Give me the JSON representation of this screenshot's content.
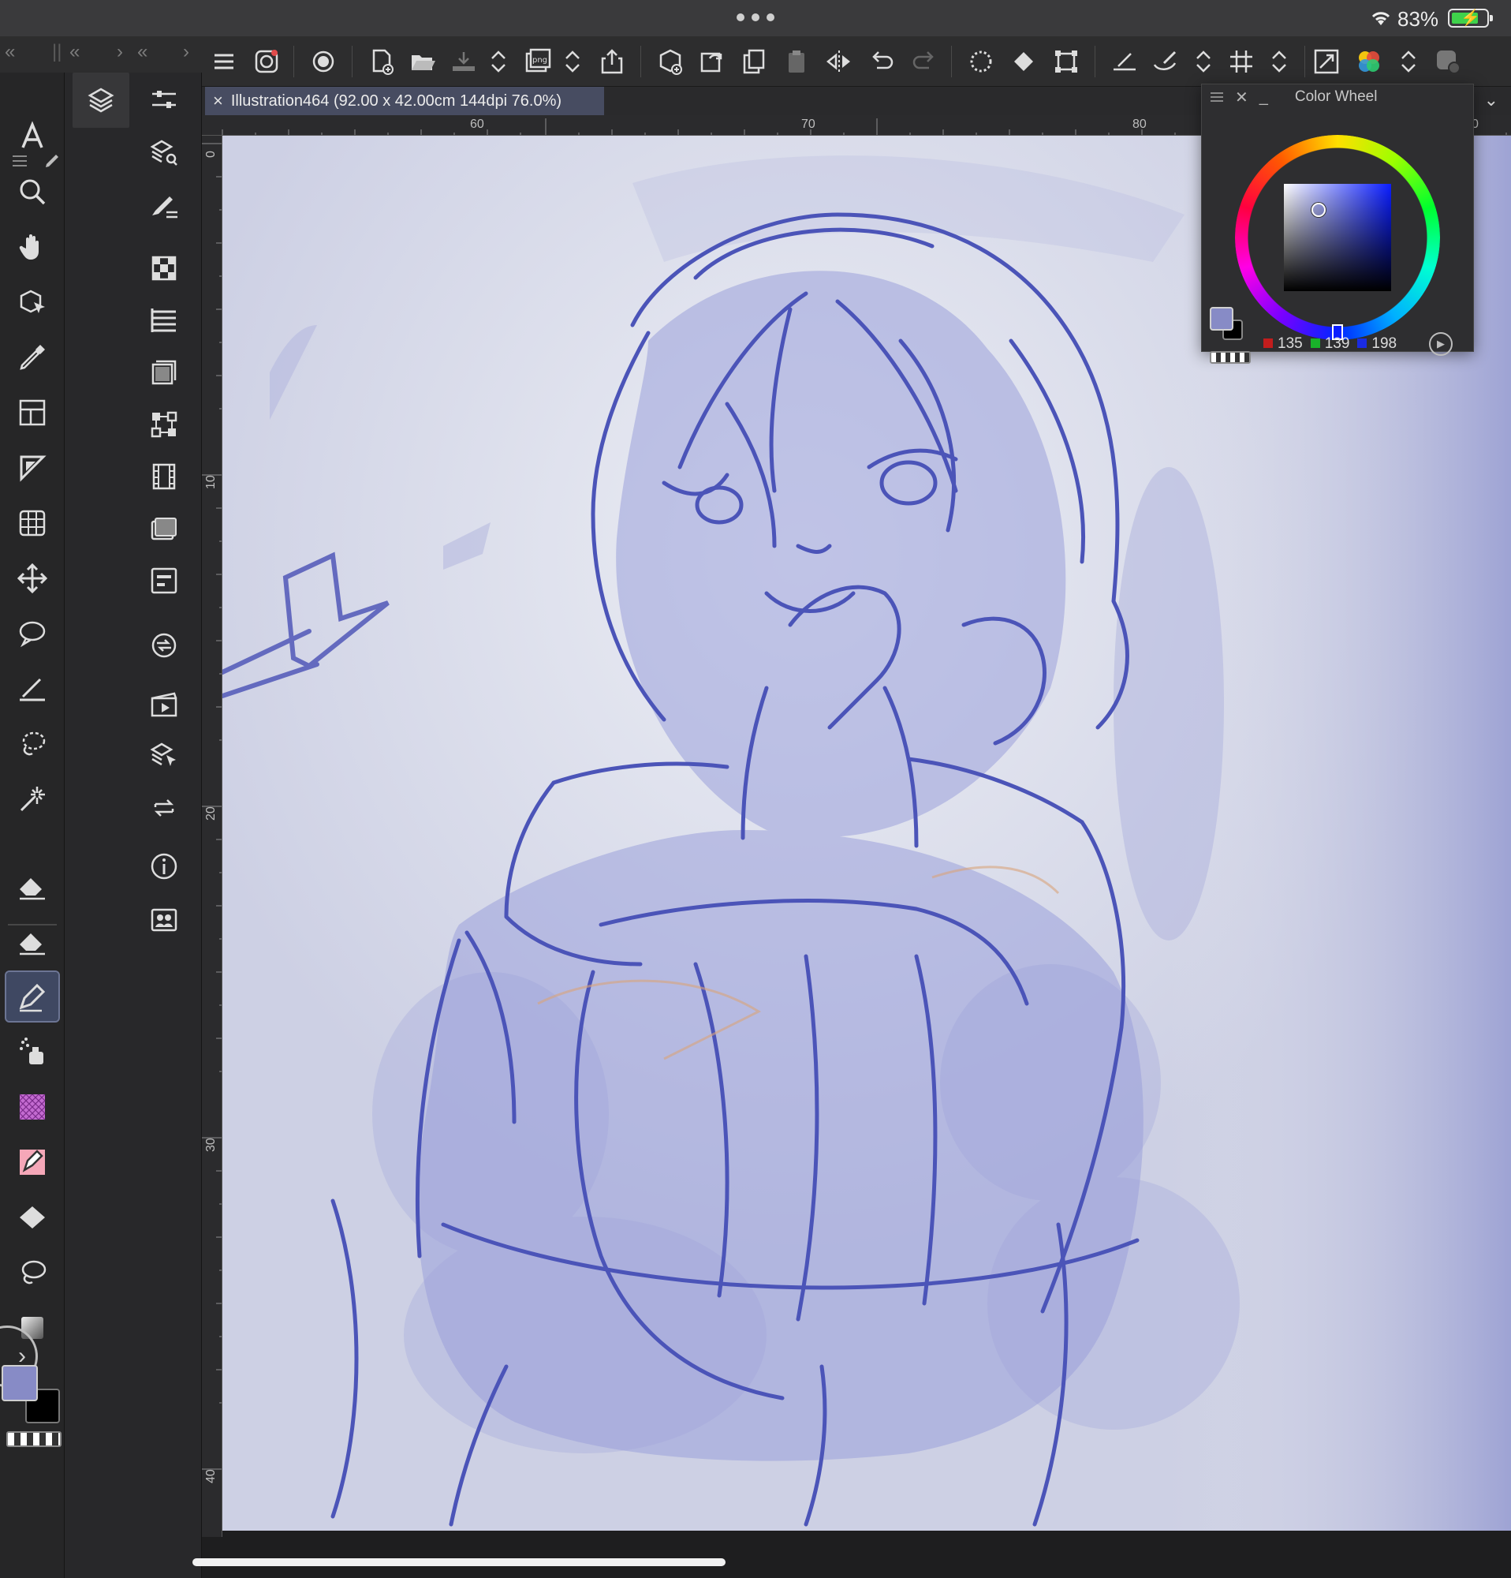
{
  "status_bar": {
    "battery_percent": "83%",
    "battery_charging": true
  },
  "toolbar": {
    "buttons": [
      "menu",
      "clip-studio-icon",
      "companion-mode",
      "new-canvas",
      "open-file",
      "save",
      "export-png",
      "share",
      "new-from-clipboard",
      "reload",
      "duplicate",
      "paste",
      "flip-horizontal",
      "undo",
      "redo",
      "selection-transform",
      "fill",
      "transform",
      "ruler-pen",
      "smoothing-brush",
      "grid",
      "fit-window",
      "color-set",
      "color-mixing"
    ]
  },
  "document": {
    "tab_title": "Illustration464 (92.00 x 42.00cm 144dpi 76.0%)"
  },
  "rulers": {
    "top_labels": [
      "60",
      "70",
      "80",
      "0"
    ],
    "left_labels": [
      "0",
      "10",
      "20",
      "30",
      "40"
    ]
  },
  "tools": {
    "main": [
      "text-tool",
      "zoom-tool",
      "hand-tool",
      "3d-object-tool",
      "eyedropper-tool",
      "frame-border-tool",
      "direct-draw-tool",
      "mesh-transform-tool",
      "move-tool",
      "lasso-selection-tool",
      "ruler-tool",
      "lasso-fill-tool",
      "sparkle-tool",
      "eraser-tool",
      "soft-eraser-tool",
      "pen-tool",
      "airbrush-tool",
      "tone-tool",
      "decoration-tool",
      "fill-tool",
      "blend-tool",
      "gradient-tool"
    ],
    "active": "pen-tool"
  },
  "palettes": {
    "buttons": [
      "layer-property",
      "layer-search",
      "sub-tool-detail",
      "navigator",
      "item-bank",
      "material",
      "timeline",
      "animation-cels",
      "layer",
      "auto-action",
      "history",
      "timeline-settings",
      "layer-select",
      "loop",
      "info",
      "artist-info"
    ]
  },
  "color_wheel": {
    "title": "Color Wheel",
    "current_color": "#878bc6",
    "sub_color": "#000000",
    "rgb": {
      "r": "135",
      "g": "139",
      "b": "198"
    },
    "hue_color": "#0a1dff"
  },
  "colors": {
    "main_color": "#878bc6",
    "sub_color": "#000000",
    "canvas_bg": "#e3e4ec",
    "sketch_line": "#4b54b8"
  }
}
